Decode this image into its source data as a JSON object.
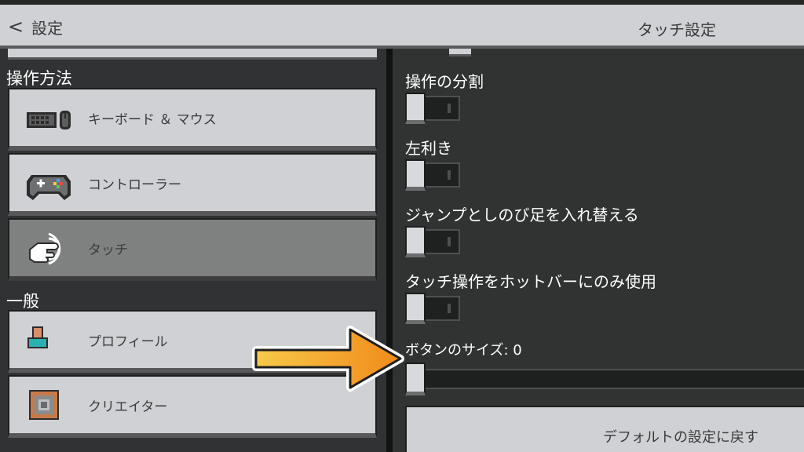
{
  "header": {
    "back_label": "設定",
    "title": "タッチ設定"
  },
  "sidebar": {
    "sections": [
      {
        "label": "操作方法",
        "items": [
          {
            "label": "キーボード ＆ マウス",
            "icon": "keyboard-mouse-icon",
            "selected": false
          },
          {
            "label": "コントローラー",
            "icon": "controller-icon",
            "selected": false
          },
          {
            "label": "タッチ",
            "icon": "touch-icon",
            "selected": true
          }
        ]
      },
      {
        "label": "一般",
        "items": [
          {
            "label": "プロフィール",
            "icon": "profile-icon",
            "selected": false
          },
          {
            "label": "クリエイター",
            "icon": "creator-icon",
            "selected": false
          }
        ]
      }
    ]
  },
  "content": {
    "options": [
      {
        "label": "操作の分割",
        "type": "toggle",
        "on": false
      },
      {
        "label": "左利き",
        "type": "toggle",
        "on": false
      },
      {
        "label": "ジャンプとしのび足を入れ替える",
        "type": "toggle",
        "on": false
      },
      {
        "label": "タッチ操作をホットバーにのみ使用",
        "type": "toggle",
        "on": false
      }
    ],
    "button_size": {
      "label": "ボタンのサイズ: 0",
      "value": 0
    },
    "reset_label": "デフォルトの設定に戻す"
  },
  "colors": {
    "button_face": "#d0d1d4",
    "selected_face": "#7f8080",
    "panel_bg": "#303331",
    "arrow_fill": "#f5a623",
    "arrow_outline": "#ffffff"
  }
}
